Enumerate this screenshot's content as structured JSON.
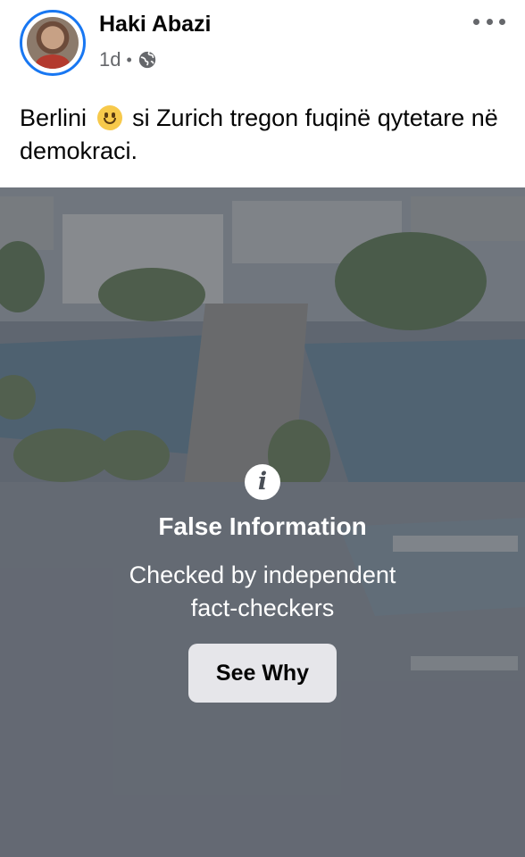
{
  "post": {
    "author_name": "Haki Abazi",
    "time": "1d",
    "separator": "•",
    "privacy_icon": "globe-icon",
    "more_icon": "more-horizontal-icon",
    "text_before_emoji": "Berlini",
    "emoji": "slightly-smiling-face-icon",
    "text_after_emoji": "si Zurich tregon fuqinë qytetare në demokraci."
  },
  "warning": {
    "icon": "info-icon",
    "icon_glyph": "i",
    "title": "False Information",
    "subtitle_line1": "Checked by independent",
    "subtitle_line2": "fact-checkers",
    "button_label": "See Why"
  },
  "colors": {
    "accent": "#1877f2",
    "overlay": "#464b55"
  }
}
